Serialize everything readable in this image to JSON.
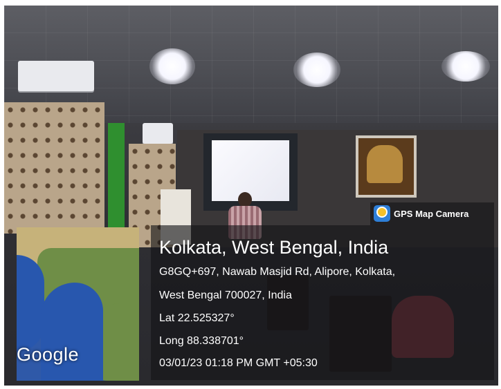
{
  "watermark": {
    "app_name": "GPS Map Camera",
    "app_icon": "gps-map-camera-icon",
    "location_title": "Kolkata, West Bengal, India",
    "address_line1": "G8GQ+697, Nawab Masjid Rd, Alipore, Kolkata,",
    "address_line2": "West Bengal 700027, India",
    "latitude": "Lat 22.525327°",
    "longitude": "Long 88.338701°",
    "datetime": "03/01/23 01:18 PM GMT +05:30",
    "map_brand": "Google"
  },
  "colors": {
    "overlay": "#141416",
    "map_sea": "#2857ae",
    "map_land": "#6f8e47"
  }
}
